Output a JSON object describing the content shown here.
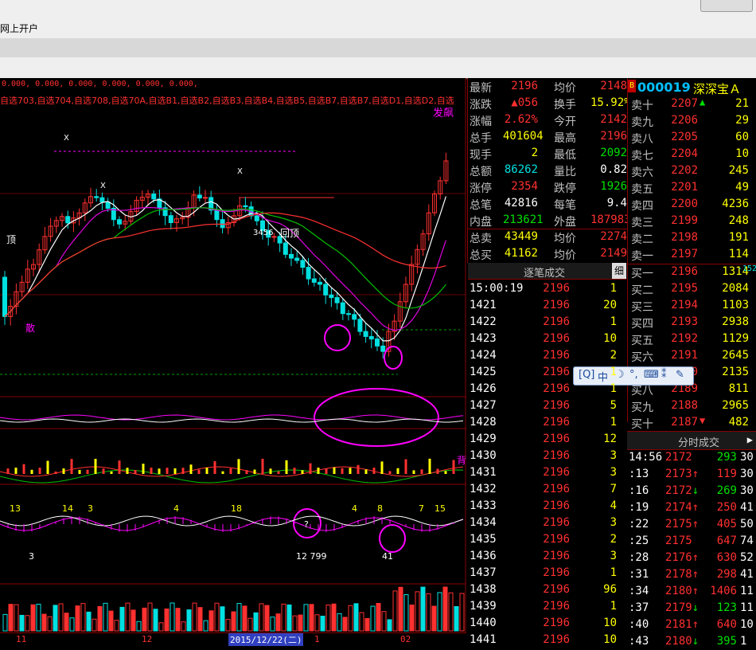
{
  "app": {
    "menu_label": "网上开户"
  },
  "chart": {
    "indicator_values": "0.000, 0.000, 0.000, 0.000, 0.000, 0.000,",
    "indicator_names": "自选703,自选704,自选708,自选70A,自选B1,自选B2,自选B3,自选B4,自选B5,自选B7,自选B7,自选D1,自选D2,自选",
    "annotations": {
      "top_right": "发飙",
      "neck": "回顶",
      "left_top": "顶",
      "left_scatter": "散",
      "kx1": "X",
      "kx2": "X",
      "kx3": "X",
      "counts": "3456",
      "q_mark": "?",
      "low_labels": "12 799",
      "lab_3": "3",
      "lab_41": "41",
      "lab_4": "4",
      "lab_8": "8",
      "lab_7": "7",
      "lab_15": "15",
      "lab_13": "13",
      "lab_14": "14",
      "lab_3b": "3",
      "lab_4b": "4",
      "lab_18": "18",
      "right_tag": "背"
    },
    "date_axis": {
      "left": "11",
      "mid": "12",
      "selected": "2015/12/22(二)",
      "after": "1",
      "right": "02"
    },
    "colors": {
      "up": "#ff3030",
      "down": "#00e0e0",
      "ma5": "#ffffff",
      "ma10": "#e000e0",
      "ma20": "#00c000",
      "ma60": "#ff3030",
      "highlight": "#ff00ff"
    }
  },
  "quote": {
    "rows": [
      {
        "l": "最新",
        "v": "2196",
        "vc": "#ff3030",
        "l2": "均价",
        "v2": "2148",
        "v2c": "#ff3030"
      },
      {
        "l": "涨跌",
        "v": "▲056",
        "vc": "#ff3030",
        "l2": "换手",
        "v2": "15.92%",
        "v2c": "#ffff00"
      },
      {
        "l": "涨幅",
        "v": "2.62%",
        "vc": "#ff3030",
        "l2": "今开",
        "v2": "2142",
        "v2c": "#ff3030"
      },
      {
        "l": "总手",
        "v": "401604",
        "vc": "#ffff00",
        "l2": "最高",
        "v2": "2196",
        "v2c": "#ff3030"
      },
      {
        "l": "现手",
        "v": "2",
        "vc": "#ffff00",
        "l2": "最低",
        "v2": "2092",
        "v2c": "#00e000"
      },
      {
        "l": "总额",
        "v": "86262",
        "vc": "#00e0e0",
        "l2": "量比",
        "v2": "0.82",
        "v2c": "#ffffff"
      },
      {
        "l": "涨停",
        "v": "2354",
        "vc": "#ff3030",
        "l2": "跌停",
        "v2": "1926",
        "v2c": "#00e000"
      },
      {
        "l": "总笔",
        "v": "42816",
        "vc": "#ffffff",
        "l2": "每笔",
        "v2": "9.4",
        "v2c": "#ffffff"
      },
      {
        "l": "内盘",
        "v": "213621",
        "vc": "#00e000",
        "l2": "外盘",
        "v2": "187983",
        "v2c": "#ff3030"
      },
      {
        "l": "总卖",
        "v": "43449",
        "vc": "#ffff00",
        "l2": "均价",
        "v2": "2274",
        "v2c": "#ff3030"
      },
      {
        "l": "总买",
        "v": "41162",
        "vc": "#ffff00",
        "l2": "均价",
        "v2": "2149",
        "v2c": "#ff3030"
      }
    ]
  },
  "orderbook": {
    "badge": "B",
    "code": "000019",
    "name": "深深宝Ａ",
    "asks": [
      {
        "l": "卖十",
        "p": "2207",
        "a": "▲",
        "ac": "#00e000",
        "q": "21"
      },
      {
        "l": "卖九",
        "p": "2206",
        "a": "",
        "ac": "#ff3030",
        "q": "29"
      },
      {
        "l": "卖八",
        "p": "2205",
        "a": "",
        "ac": "#ff3030",
        "q": "60"
      },
      {
        "l": "卖七",
        "p": "2204",
        "a": "",
        "ac": "#ff3030",
        "q": "10"
      },
      {
        "l": "卖六",
        "p": "2202",
        "a": "",
        "ac": "#ff3030",
        "q": "245"
      },
      {
        "l": "卖五",
        "p": "2201",
        "a": "",
        "ac": "#ff3030",
        "q": "49"
      },
      {
        "l": "卖四",
        "p": "2200",
        "a": "",
        "ac": "#ff3030",
        "q": "4236"
      },
      {
        "l": "卖三",
        "p": "2199",
        "a": "",
        "ac": "#ff3030",
        "q": "248"
      },
      {
        "l": "卖二",
        "p": "2198",
        "a": "",
        "ac": "#ff3030",
        "q": "191"
      },
      {
        "l": "卖一",
        "p": "2197",
        "a": "",
        "ac": "#ff3030",
        "q": "114"
      }
    ],
    "bids": [
      {
        "l": "买一",
        "p": "2196",
        "a": "",
        "ac": "#ff3030",
        "q": "1314",
        "extra": "-152"
      },
      {
        "l": "买二",
        "p": "2195",
        "a": "",
        "ac": "#ff3030",
        "q": "2084"
      },
      {
        "l": "买三",
        "p": "2194",
        "a": "",
        "ac": "#ff3030",
        "q": "1103"
      },
      {
        "l": "买四",
        "p": "2193",
        "a": "",
        "ac": "#ff3030",
        "q": "2938"
      },
      {
        "l": "买五",
        "p": "2192",
        "a": "",
        "ac": "#ff3030",
        "q": "1129"
      },
      {
        "l": "买六",
        "p": "2191",
        "a": "",
        "ac": "#ff3030",
        "q": "2645"
      },
      {
        "l": "买七",
        "p": "2190",
        "a": "",
        "ac": "#ff3030",
        "q": "2135"
      },
      {
        "l": "买八",
        "p": "2189",
        "a": "",
        "ac": "#ff3030",
        "q": "811"
      },
      {
        "l": "买九",
        "p": "2188",
        "a": "",
        "ac": "#ff3030",
        "q": "2965"
      },
      {
        "l": "买十",
        "p": "2187",
        "a": "▼",
        "ac": "#ff3030",
        "q": "482"
      }
    ]
  },
  "floating_toolbar": {
    "ime": "中",
    "items": [
      "IQ",
      "中",
      "☽",
      "°,",
      "⌨",
      "✎",
      "🔧"
    ]
  },
  "trades": {
    "title": "逐笔成交",
    "detail": "细",
    "rows": [
      {
        "t": "15:00:19",
        "p": "2196",
        "v": "1"
      },
      {
        "t": "1421",
        "p": "2196",
        "v": "20"
      },
      {
        "t": "1422",
        "p": "2196",
        "v": "1"
      },
      {
        "t": "1423",
        "p": "2196",
        "v": "10"
      },
      {
        "t": "1424",
        "p": "2196",
        "v": "2"
      },
      {
        "t": "1425",
        "p": "2196",
        "v": "1"
      },
      {
        "t": "1426",
        "p": "2196",
        "v": "1"
      },
      {
        "t": "1427",
        "p": "2196",
        "v": "5"
      },
      {
        "t": "1428",
        "p": "2196",
        "v": "1"
      },
      {
        "t": "1429",
        "p": "2196",
        "v": "12"
      },
      {
        "t": "1430",
        "p": "2196",
        "v": "3"
      },
      {
        "t": "1431",
        "p": "2196",
        "v": "3"
      },
      {
        "t": "1432",
        "p": "2196",
        "v": "7"
      },
      {
        "t": "1433",
        "p": "2196",
        "v": "4"
      },
      {
        "t": "1434",
        "p": "2196",
        "v": "3"
      },
      {
        "t": "1435",
        "p": "2196",
        "v": "2"
      },
      {
        "t": "1436",
        "p": "2196",
        "v": "3"
      },
      {
        "t": "1437",
        "p": "2196",
        "v": "1"
      },
      {
        "t": "1438",
        "p": "2196",
        "v": "96"
      },
      {
        "t": "1439",
        "p": "2196",
        "v": "1"
      },
      {
        "t": "1440",
        "p": "2196",
        "v": "10"
      },
      {
        "t": "1441",
        "p": "2196",
        "v": "10"
      }
    ]
  },
  "timesales": {
    "title": "分时成交",
    "arrow": "▶",
    "rows": [
      {
        "t": "14:56",
        "p": "2172",
        "a": "",
        "ac": "#ff3030",
        "v": "293",
        "vc": "#00e000",
        "e": "30"
      },
      {
        "t": ":13",
        "p": "2173",
        "a": "↑",
        "ac": "#ff3030",
        "v": "119",
        "vc": "#ff3030",
        "e": "30"
      },
      {
        "t": ":16",
        "p": "2172",
        "a": "↓",
        "ac": "#00e000",
        "v": "269",
        "vc": "#00e000",
        "e": "30"
      },
      {
        "t": ":19",
        "p": "2174",
        "a": "↑",
        "ac": "#ff3030",
        "v": "250",
        "vc": "#ff3030",
        "e": "41"
      },
      {
        "t": ":22",
        "p": "2175",
        "a": "↑",
        "ac": "#ff3030",
        "v": "405",
        "vc": "#ff3030",
        "e": "50"
      },
      {
        "t": ":25",
        "p": "2175",
        "a": "",
        "ac": "#ff3030",
        "v": "647",
        "vc": "#ff3030",
        "e": "74"
      },
      {
        "t": ":28",
        "p": "2176",
        "a": "↑",
        "ac": "#ff3030",
        "v": "630",
        "vc": "#ff3030",
        "e": "52"
      },
      {
        "t": ":31",
        "p": "2178",
        "a": "↑",
        "ac": "#ff3030",
        "v": "298",
        "vc": "#ff3030",
        "e": "41"
      },
      {
        "t": ":34",
        "p": "2180",
        "a": "↑",
        "ac": "#ff3030",
        "v": "1406",
        "vc": "#ff3030",
        "e": "11"
      },
      {
        "t": ":37",
        "p": "2179",
        "a": "↓",
        "ac": "#00e000",
        "v": "123",
        "vc": "#00e000",
        "e": "11"
      },
      {
        "t": ":40",
        "p": "2181",
        "a": "↑",
        "ac": "#ff3030",
        "v": "640",
        "vc": "#ff3030",
        "e": "10"
      },
      {
        "t": ":43",
        "p": "2180",
        "a": "↓",
        "ac": "#00e000",
        "v": "395",
        "vc": "#00e000",
        "e": "1"
      }
    ]
  }
}
